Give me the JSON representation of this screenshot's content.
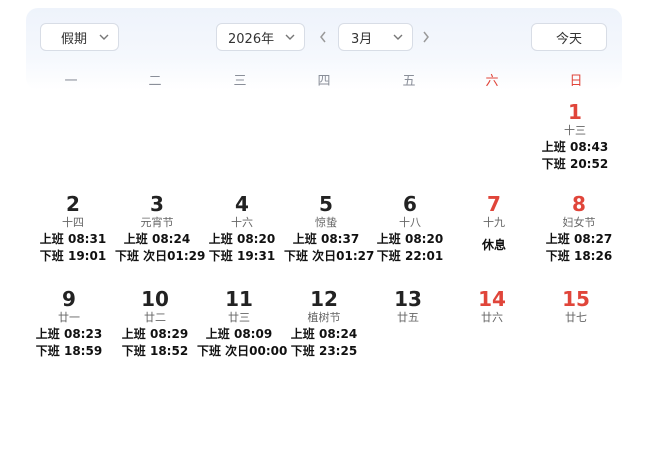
{
  "toolbar": {
    "holiday_label": "假期",
    "year_label": "2026年",
    "month_label": "3月",
    "today_label": "今天"
  },
  "weekdays": [
    "一",
    "二",
    "三",
    "四",
    "五",
    "六",
    "日"
  ],
  "colors": {
    "weekend": "#e0453a",
    "text": "#111111",
    "lunar": "#666666"
  },
  "days": [
    {
      "day": "1",
      "lunar": "十三",
      "on": "上班 08:43",
      "off": "下班 20:52",
      "rest": ""
    },
    {
      "day": "2",
      "lunar": "十四",
      "on": "上班 08:31",
      "off": "下班 19:01",
      "rest": ""
    },
    {
      "day": "3",
      "lunar": "元宵节",
      "on": "上班 08:24",
      "off": "下班 次日01:29",
      "rest": ""
    },
    {
      "day": "4",
      "lunar": "十六",
      "on": "上班 08:20",
      "off": "下班 19:31",
      "rest": ""
    },
    {
      "day": "5",
      "lunar": "惊蛰",
      "on": "上班 08:37",
      "off": "下班 次日01:27",
      "rest": ""
    },
    {
      "day": "6",
      "lunar": "十八",
      "on": "上班 08:20",
      "off": "下班 22:01",
      "rest": ""
    },
    {
      "day": "7",
      "lunar": "十九",
      "on": "",
      "off": "",
      "rest": "休息"
    },
    {
      "day": "8",
      "lunar": "妇女节",
      "on": "上班 08:27",
      "off": "下班 18:26",
      "rest": ""
    },
    {
      "day": "9",
      "lunar": "廿一",
      "on": "上班 08:23",
      "off": "下班 18:59",
      "rest": ""
    },
    {
      "day": "10",
      "lunar": "廿二",
      "on": "上班 08:29",
      "off": "下班 18:52",
      "rest": ""
    },
    {
      "day": "11",
      "lunar": "廿三",
      "on": "上班 08:09",
      "off": "下班 次日00:00",
      "rest": ""
    },
    {
      "day": "12",
      "lunar": "植树节",
      "on": "上班 08:24",
      "off": "下班 23:25",
      "rest": ""
    },
    {
      "day": "13",
      "lunar": "廿五",
      "on": "",
      "off": "",
      "rest": ""
    },
    {
      "day": "14",
      "lunar": "廿六",
      "on": "",
      "off": "",
      "rest": ""
    },
    {
      "day": "15",
      "lunar": "廿七",
      "on": "",
      "off": "",
      "rest": ""
    }
  ]
}
